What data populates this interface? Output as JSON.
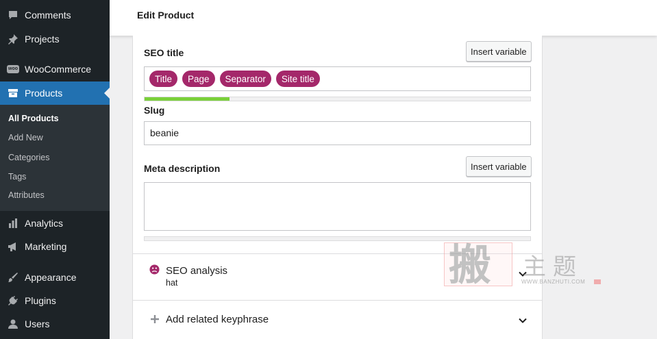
{
  "sidebar": {
    "items": [
      {
        "label": "Comments",
        "icon": "comment-icon"
      },
      {
        "label": "Projects",
        "icon": "pin-icon"
      },
      {
        "label": "WooCommerce",
        "icon": "woo-icon"
      },
      {
        "label": "Products",
        "icon": "archive-icon",
        "active": true
      },
      {
        "label": "Analytics",
        "icon": "bar-chart-icon"
      },
      {
        "label": "Marketing",
        "icon": "megaphone-icon"
      },
      {
        "label": "Appearance",
        "icon": "brush-icon"
      },
      {
        "label": "Plugins",
        "icon": "plug-icon"
      },
      {
        "label": "Users",
        "icon": "user-icon"
      }
    ],
    "woo_badge": "woo",
    "submenu": [
      "All Products",
      "Add New",
      "Categories",
      "Tags",
      "Attributes"
    ]
  },
  "header": {
    "title": "Edit Product"
  },
  "seo": {
    "seo_title_label": "SEO title",
    "insert_variable": "Insert variable",
    "chips": [
      "Title",
      "Page",
      "Separator",
      "Site title"
    ],
    "title_progress": 0.22,
    "slug_label": "Slug",
    "slug_value": "beanie",
    "meta_label": "Meta description",
    "meta_progress": 0
  },
  "analysis": {
    "title": "SEO analysis",
    "keyphrase": "hat"
  },
  "related": {
    "title": "Add related keyphrase"
  },
  "watermark": {
    "big": "搬",
    "small": "主题",
    "url": "WWW.BANZHUTI.COM"
  },
  "colors": {
    "sidebar_bg": "#1d2327",
    "active": "#2271b1",
    "chip": "#a4286a",
    "progress": "#7ad03a",
    "sad_face": "#a4286a"
  }
}
